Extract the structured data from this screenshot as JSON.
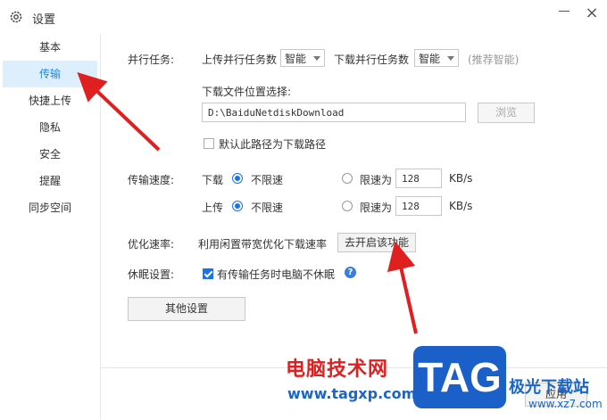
{
  "window": {
    "title": "设置",
    "settings_icon": "gear-icon",
    "minimize_icon": "minimize-icon",
    "close_label": "×"
  },
  "sidebar": {
    "items": [
      {
        "label": "基本"
      },
      {
        "label": "传输",
        "active": true
      },
      {
        "label": "快捷上传"
      },
      {
        "label": "隐私"
      },
      {
        "label": "安全"
      },
      {
        "label": "提醒"
      },
      {
        "label": "同步空间"
      }
    ]
  },
  "parallel": {
    "label": "并行任务:",
    "upload_label": "上传并行任务数",
    "upload_value": "智能",
    "download_label": "下载并行任务数",
    "download_value": "智能",
    "hint": "(推荐智能)"
  },
  "download_location": {
    "label": "下载文件位置选择:",
    "path": "D:\\BaiduNetdiskDownload",
    "browse_label": "浏览",
    "default_checkbox_label": "默认此路径为下载路径",
    "default_checked": false
  },
  "speed": {
    "label": "传输速度:",
    "download": {
      "label": "下载",
      "unlimited": "不限速",
      "limit": "限速为",
      "value": "128",
      "unit": "KB/s",
      "selected": "unlimited"
    },
    "upload": {
      "label": "上传",
      "unlimited": "不限速",
      "limit": "限速为",
      "value": "128",
      "unit": "KB/s",
      "selected": "unlimited"
    }
  },
  "optimize": {
    "label": "优化速率:",
    "desc": "利用闲置带宽优化下载速率",
    "button": "去开启该功能"
  },
  "sleep": {
    "label": "休眠设置:",
    "checkbox_label": "有传输任务时电脑不休眠",
    "checked": true,
    "help_icon": "help-icon",
    "help_glyph": "?"
  },
  "other_button": "其他设置",
  "footer": {
    "apply_label": "应用"
  },
  "watermark": {
    "line1": "电脑技术网",
    "line2": "www.tagxp.com",
    "logo": "TAG",
    "site": "极光下载站",
    "url": "www.xz7.com"
  },
  "colors": {
    "accent": "#1a73e8",
    "active_bg": "#ddeefc",
    "arrow": "#e02020"
  }
}
